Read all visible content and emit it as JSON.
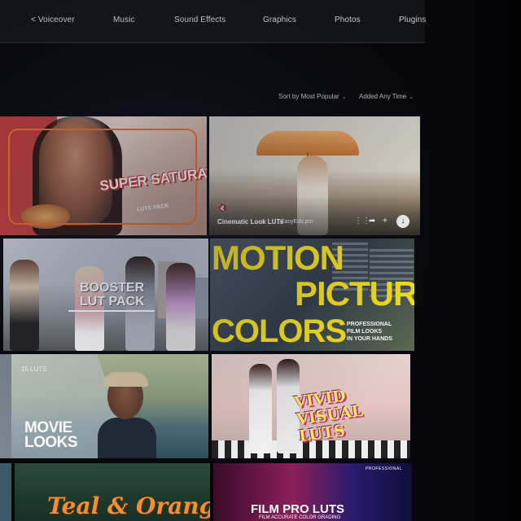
{
  "nav": {
    "items": [
      "< Voiceover",
      "Music",
      "Sound Effects",
      "Graphics",
      "Photos",
      "Plugins"
    ]
  },
  "sort": {
    "sort_label": "Sort by Most Popular",
    "date_label": "Added Any Time"
  },
  "tiles": {
    "t1": {
      "title": "SUPER SATURATED",
      "subtitle": "LUTS PACK"
    },
    "t2": {
      "name": "Cinematic Look LUTs",
      "author": "EasyEdit.pro",
      "mute_icon": "mute-icon",
      "download_icon": "download-icon"
    },
    "t3": {
      "title_line1": "BOOSTER",
      "title_line2": "LUT PACK"
    },
    "t4": {
      "line1": "MOTION",
      "line2": "PICTURE",
      "line3": "COLORS",
      "sub1": "PROFESSIONAL",
      "sub2": "FILM LOOKS",
      "sub3": "IN YOUR HANDS"
    },
    "t5": {
      "count": "15 LUTS",
      "title_line1": "MOVIE",
      "title_line2": "LOOKS"
    },
    "t6": {
      "title_line1": "VIVID",
      "title_line2": "VISUAL",
      "title_line3": "LUTS"
    },
    "t7": {
      "title": "Teal & Orange"
    },
    "t8": {
      "label": "PROFESSIONAL",
      "title": "FILM PRO LUTS",
      "subtitle": "FILM ACCURATE COLOR GRADING"
    }
  },
  "colors": {
    "background": "#07070b",
    "nav_bg": "#111318",
    "accent_orange": "#f26b1d",
    "accent_yellow": "#f5e01a"
  }
}
